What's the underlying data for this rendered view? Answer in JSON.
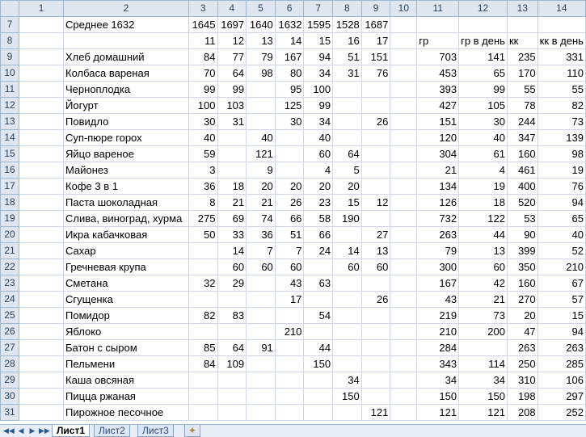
{
  "columns": [
    "",
    "1",
    "2",
    "3",
    "4",
    "5",
    "6",
    "7",
    "8",
    "9",
    "10",
    "11",
    "12",
    "13",
    "14"
  ],
  "rows": [
    {
      "n": "7",
      "cells": [
        "",
        "Среднее 1632",
        "1645",
        "1697",
        "1640",
        "1632",
        "1595",
        "1528",
        "1687",
        "",
        "",
        "",
        "",
        ""
      ]
    },
    {
      "n": "8",
      "cells": [
        "",
        "",
        "11",
        "12",
        "13",
        "14",
        "15",
        "16",
        "17",
        "",
        "гр",
        "гр в день",
        "кк",
        "кк в день"
      ]
    },
    {
      "n": "9",
      "cells": [
        "",
        "Хлеб домашний",
        "84",
        "77",
        "79",
        "167",
        "94",
        "51",
        "151",
        "",
        "703",
        "141",
        "235",
        "331"
      ]
    },
    {
      "n": "10",
      "cells": [
        "",
        "Колбаса вареная",
        "70",
        "64",
        "98",
        "80",
        "34",
        "31",
        "76",
        "",
        "453",
        "65",
        "170",
        "110"
      ]
    },
    {
      "n": "11",
      "cells": [
        "",
        "Черноплодка",
        "99",
        "99",
        "",
        "95",
        "100",
        "",
        "",
        "",
        "393",
        "99",
        "55",
        "55"
      ]
    },
    {
      "n": "12",
      "cells": [
        "",
        "Йогурт",
        "100",
        "103",
        "",
        "125",
        "99",
        "",
        "",
        "",
        "427",
        "105",
        "78",
        "82"
      ]
    },
    {
      "n": "13",
      "cells": [
        "",
        "Повидло",
        "30",
        "31",
        "",
        "30",
        "34",
        "",
        "26",
        "",
        "151",
        "30",
        "244",
        "73"
      ]
    },
    {
      "n": "14",
      "cells": [
        "",
        "Суп-пюре горох",
        "40",
        "",
        "40",
        "",
        "40",
        "",
        "",
        "",
        "120",
        "40",
        "347",
        "139"
      ]
    },
    {
      "n": "15",
      "cells": [
        "",
        "Яйцо вареное",
        "59",
        "",
        "121",
        "",
        "60",
        "64",
        "",
        "",
        "304",
        "61",
        "160",
        "98"
      ]
    },
    {
      "n": "16",
      "cells": [
        "",
        "Майонез",
        "3",
        "",
        "9",
        "",
        "4",
        "5",
        "",
        "",
        "21",
        "4",
        "461",
        "19"
      ]
    },
    {
      "n": "17",
      "cells": [
        "",
        "Кофе 3 в 1",
        "36",
        "18",
        "20",
        "20",
        "20",
        "20",
        "",
        "",
        "134",
        "19",
        "400",
        "76"
      ]
    },
    {
      "n": "18",
      "cells": [
        "",
        "Паста шоколадная",
        "8",
        "21",
        "21",
        "26",
        "23",
        "15",
        "12",
        "",
        "126",
        "18",
        "520",
        "94"
      ]
    },
    {
      "n": "19",
      "cells": [
        "",
        "Слива, виноград, хурма",
        "275",
        "69",
        "74",
        "66",
        "58",
        "190",
        "",
        "",
        "732",
        "122",
        "53",
        "65"
      ]
    },
    {
      "n": "20",
      "cells": [
        "",
        "Икра кабачковая",
        "50",
        "33",
        "36",
        "51",
        "66",
        "",
        "27",
        "",
        "263",
        "44",
        "90",
        "40"
      ]
    },
    {
      "n": "21",
      "cells": [
        "",
        "Сахар",
        "",
        "14",
        "7",
        "7",
        "24",
        "14",
        "13",
        "",
        "79",
        "13",
        "399",
        "52"
      ]
    },
    {
      "n": "22",
      "cells": [
        "",
        "Гречневая крупа",
        "",
        "60",
        "60",
        "60",
        "",
        "60",
        "60",
        "",
        "300",
        "60",
        "350",
        "210"
      ]
    },
    {
      "n": "23",
      "cells": [
        "",
        "Сметана",
        "32",
        "29",
        "",
        "43",
        "63",
        "",
        "",
        "",
        "167",
        "42",
        "160",
        "67"
      ]
    },
    {
      "n": "24",
      "cells": [
        "",
        "Сгущенка",
        "",
        "",
        "",
        "17",
        "",
        "",
        "26",
        "",
        "43",
        "21",
        "270",
        "57"
      ]
    },
    {
      "n": "25",
      "cells": [
        "",
        "Помидор",
        "82",
        "83",
        "",
        "",
        "54",
        "",
        "",
        "",
        "219",
        "73",
        "20",
        "15"
      ]
    },
    {
      "n": "26",
      "cells": [
        "",
        "Яблоко",
        "",
        "",
        "",
        "210",
        "",
        "",
        "",
        "",
        "210",
        "200",
        "47",
        "94"
      ]
    },
    {
      "n": "27",
      "cells": [
        "",
        "Батон с сыром",
        "85",
        "64",
        "91",
        "",
        "44",
        "",
        "",
        "",
        "284",
        "",
        "263",
        "263"
      ]
    },
    {
      "n": "28",
      "cells": [
        "",
        "Пельмени",
        "84",
        "109",
        "",
        "",
        "150",
        "",
        "",
        "",
        "343",
        "114",
        "250",
        "285"
      ]
    },
    {
      "n": "29",
      "cells": [
        "",
        "Каша овсяная",
        "",
        "",
        "",
        "",
        "",
        "34",
        "",
        "",
        "34",
        "34",
        "310",
        "106"
      ]
    },
    {
      "n": "30",
      "cells": [
        "",
        "Пицца ржаная",
        "",
        "",
        "",
        "",
        "",
        "150",
        "",
        "",
        "150",
        "150",
        "198",
        "297"
      ]
    },
    {
      "n": "31",
      "cells": [
        "",
        "Пирожное песочное",
        "",
        "",
        "",
        "",
        "",
        "",
        "121",
        "",
        "121",
        "121",
        "208",
        "252"
      ]
    }
  ],
  "sheets": [
    "Лист1",
    "Лист2",
    "Лист3"
  ],
  "active_sheet": "Лист1",
  "nav_icons": [
    "first-sheet-icon",
    "prev-sheet-icon",
    "next-sheet-icon",
    "last-sheet-icon"
  ],
  "new_sheet_icon": "insert-sheet-icon"
}
